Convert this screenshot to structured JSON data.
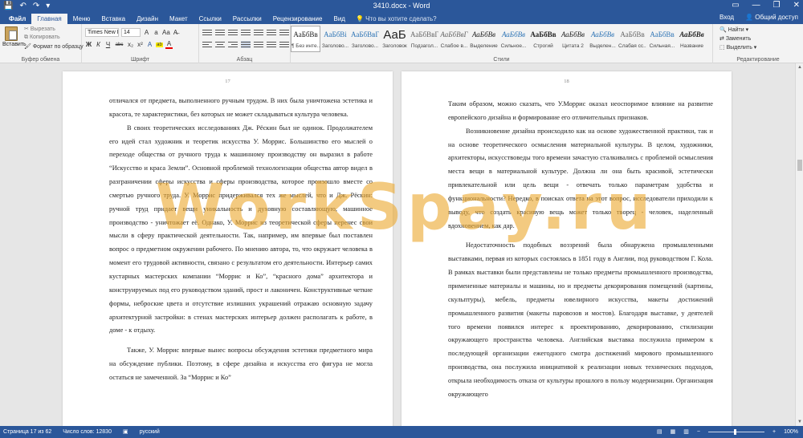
{
  "titlebar": {
    "title": "3410.docx - Word",
    "qat": [
      "💾",
      "↶",
      "↷",
      "▾"
    ],
    "winctl": [
      "▭",
      "—",
      "❐",
      "✕"
    ]
  },
  "tabs": {
    "file": "Файл",
    "items": [
      "Главная",
      "Меню",
      "Вставка",
      "Дизайн",
      "Макет",
      "Ссылки",
      "Рассылки",
      "Рецензирование",
      "Вид"
    ],
    "active": "Главная",
    "tell_me": "Что вы хотите сделать?",
    "sign_in": "Вход",
    "share": "Общий доступ"
  },
  "ribbon": {
    "clipboard": {
      "label": "Буфер обмена",
      "paste": "Вставить",
      "cut": "Вырезать",
      "copy": "Копировать",
      "format_painter": "Формат по образцу"
    },
    "font": {
      "label": "Шрифт",
      "family": "Times New F",
      "size": "14",
      "row2": [
        "Ж",
        "К",
        "Ч",
        "abc",
        "x₂",
        "x²",
        "A",
        "ab",
        "A"
      ]
    },
    "paragraph": {
      "label": "Абзац"
    },
    "styles": {
      "label": "Стили",
      "items": [
        {
          "sample": "АаБбВв",
          "name": "¶ Без инте..."
        },
        {
          "sample": "АаБбВі",
          "name": "Заголово..."
        },
        {
          "sample": "АаБбВвГ",
          "name": "Заголово..."
        },
        {
          "sample": "АаБ",
          "name": "Заголовок"
        },
        {
          "sample": "АаБбВвГ",
          "name": "Подзагол..."
        },
        {
          "sample": "АаБбВвГ",
          "name": "Слабое в..."
        },
        {
          "sample": "АаБбВв",
          "name": "Выделение"
        },
        {
          "sample": "АаБбВв",
          "name": "Сильное..."
        },
        {
          "sample": "АаБбВв",
          "name": "Строгий"
        },
        {
          "sample": "АаБбВв",
          "name": "Цитата 2"
        },
        {
          "sample": "АаБбВв",
          "name": "Выделен..."
        },
        {
          "sample": "АаБбВв",
          "name": "Слабая сс..."
        },
        {
          "sample": "АаБбВв",
          "name": "Сильная..."
        },
        {
          "sample": "АаБбВв",
          "name": "Название"
        }
      ]
    },
    "editing": {
      "label": "Редактирование",
      "find": "Найти",
      "replace": "Заменить",
      "select": "Выделить"
    }
  },
  "pages": {
    "left": {
      "number": "17",
      "paragraphs": [
        "отличался от предмета, выполненного ручным трудом. В них была уничтожена эстетика и красота, те характеристики, без которых не может складываться культура человека.",
        "В своих теоретических исследованиях Дж. Рёскин был не одинок. Продолжателем его идей стал художник и теоретик искусства У. Моррис. Большинство его мыслей о переходе общества от ручного труда к машинному производству он выразил в работе “Искусство и краса Земли”. Основной проблемой технологизации общества автор видел в разграничении сферы искусства и сферы производства, которое произошло вместе со смертью ручного труда. У. Моррис придерживался тех же мыслей, что и Дж. Рёскин: ручной труд придает вещи уникальность и духовную составляющую, машинное производство - уничтожает её. Однако, У. Моррис из теоретической сферы перенес свои мысли в сферу практической деятельности. Так, например, им впервые был поставлен вопрос о предметном окружении рабочего. По мнению автора, то, что окружает человека в момент его трудовой активности, связано с результатом его деятельности. Интерьер самих кустарных мастерских компании “Моррис и Ко”, “красного дома” архитектора и конструируемых под его руководством зданий, прост и лаконичен. Конструктивные четкие формы, неброские цвета и отсутствие излишних украшений отражаю основную задачу архитектурной застройки: в стенах мастерских интерьер должен располагать к работе, в доме - к отдыху.",
        "Также, У. Моррис впервые вынес вопросы обсуждения эстетики предметного мира на обсуждение публики. Поэтому, в сфере дизайна и искусства его фигура не могла остаться не замеченной. За “Моррис и Ко”"
      ]
    },
    "right": {
      "number": "18",
      "paragraphs": [
        "Таким образом, можно сказать, что У.Моррис оказал неоспоримое влияние на развитие европейского дизайна и формирование его отличительных признаков.",
        "Возникновение дизайна происходило как на основе художественной практики, так и на основе теоретического осмысления материальной культуры. В целом, художники, архитекторы, искусствоведы того времени зачастую сталкивались с проблемой осмысления места вещи в материальной культуре. Должна ли она быть красивой, эстетически привлекательной или цель вещи - отвечать только параметрам удобства и функциональности? Нередко, в поисках ответа на этот вопрос, исследователи приходили к выводу, что создать красивую вещь может только творец - человек, наделенный вдохновением, как дар.",
        "Недостаточность подобных воззрений была обнаружена промышленными выставками, первая из которых состоялась в 1851 году в Англии, под руководством Г. Кола. В рамках выставки были представлены не только предметы промышленного производства, примененные материалы и машины, но и предметы декорирования помещений (картины, скульптуры), мебель, предметы ювелирного искусства, макеты достижений промышленного развития (макеты паровозов и мостов). Благодаря выставке, у деятелей того времени появился интерес к проектированию, декорированию, стилизации окружающего пространства человека. Английская выставка послужила примером к последующей организации ежегодного смотра достижений мирового промышленного производства, она послужила инициативой к реализации новых технических подходов, открыла необходимость отказа от культуры прошлого в пользу модернизации. Организация окружающего"
      ]
    }
  },
  "watermark": "WorkSpay.ru",
  "statusbar": {
    "page": "Страница 17 из 62",
    "words": "Число слов: 12830",
    "lang": "русский",
    "zoom": "100%",
    "zoom_level": 0.5
  }
}
